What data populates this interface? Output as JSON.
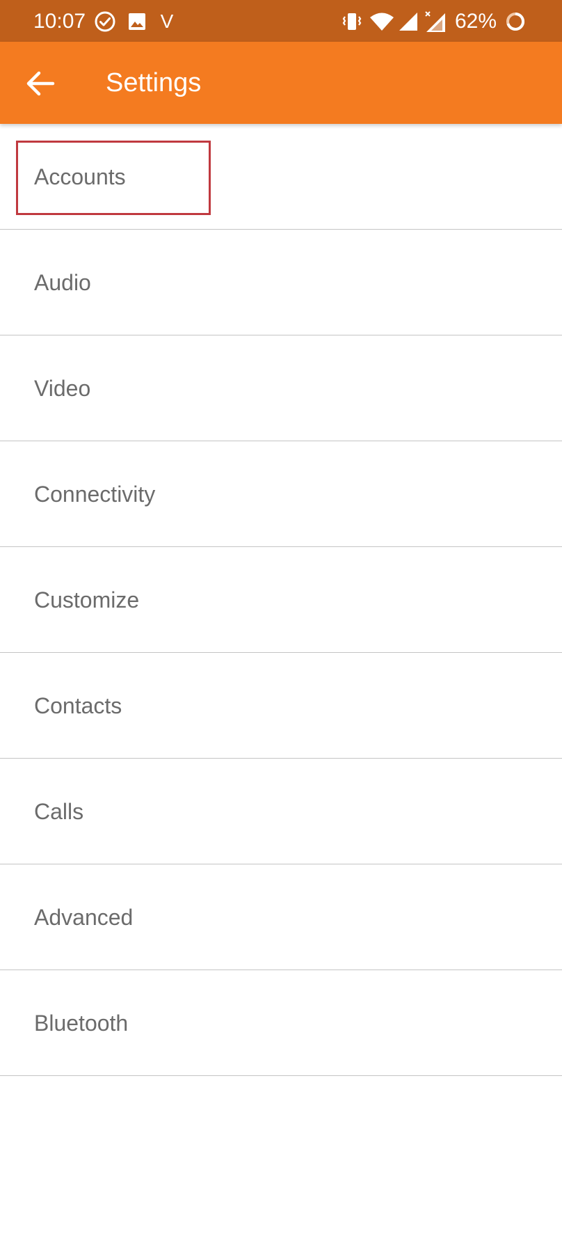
{
  "status_bar": {
    "time": "10:07",
    "carrier_glyph": "V",
    "battery_percent": "62%",
    "icons": [
      "check-circle-icon",
      "image-icon",
      "vibrate-icon",
      "wifi-icon",
      "signal-icon",
      "signal-no-data-icon",
      "battery-ring-icon"
    ]
  },
  "app_bar": {
    "title": "Settings",
    "back_icon": "arrow-left-icon"
  },
  "settings": {
    "items": [
      {
        "label": "Accounts",
        "highlighted": true
      },
      {
        "label": "Audio"
      },
      {
        "label": "Video"
      },
      {
        "label": "Connectivity"
      },
      {
        "label": "Customize"
      },
      {
        "label": "Contacts"
      },
      {
        "label": "Calls"
      },
      {
        "label": "Advanced"
      },
      {
        "label": "Bluetooth"
      }
    ]
  },
  "colors": {
    "status_bar": "#bf5f1b",
    "app_bar": "#f47b20",
    "highlight": "#c0393f",
    "item_text": "#6b6b6b",
    "divider": "#c4c4c4"
  }
}
